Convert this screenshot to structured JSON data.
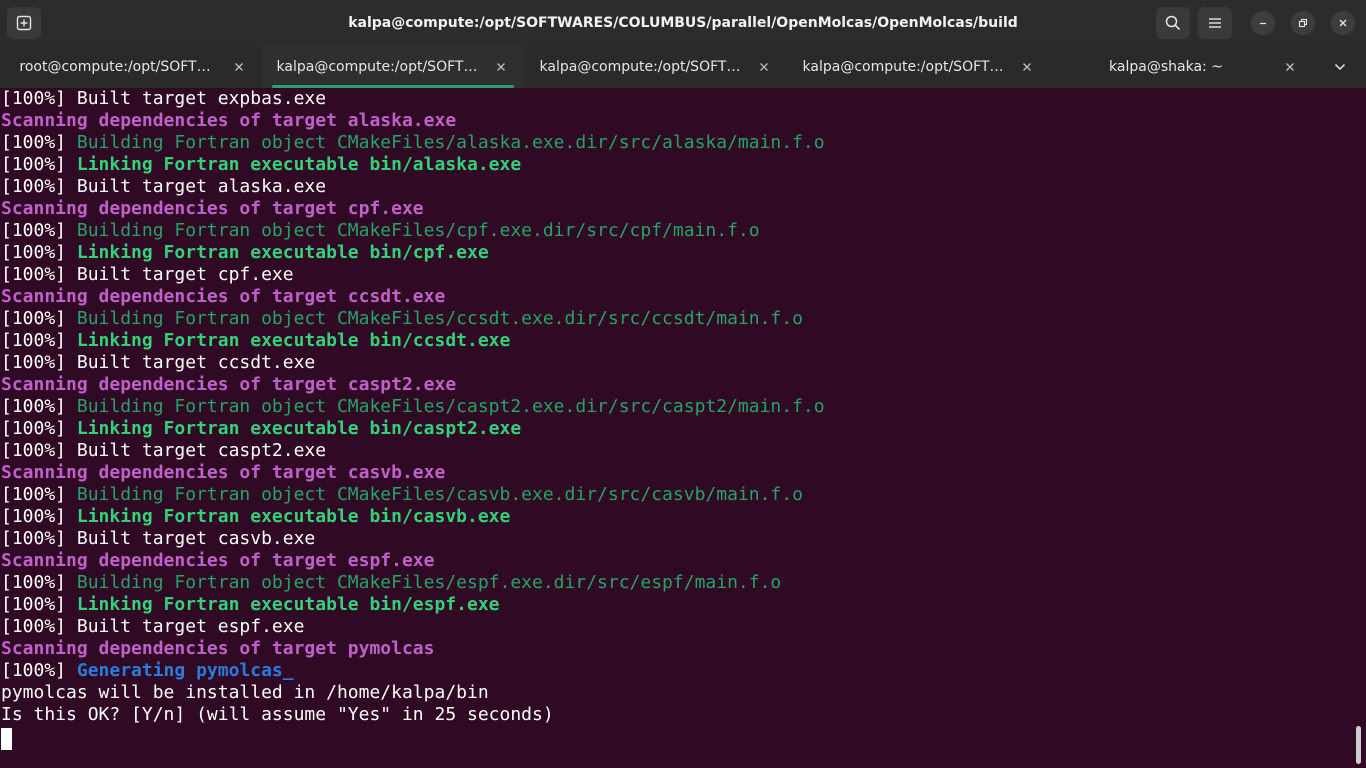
{
  "window": {
    "title": "kalpa@compute:/opt/SOFTWARES/COLUMBUS/parallel/OpenMolcas/OpenMolcas/build"
  },
  "tabs": [
    {
      "label": "root@compute:/opt/SOFT…",
      "active": false
    },
    {
      "label": "kalpa@compute:/opt/SOFT…",
      "active": true
    },
    {
      "label": "kalpa@compute:/opt/SOFT…",
      "active": false
    },
    {
      "label": "kalpa@compute:/opt/SOFT…",
      "active": false
    },
    {
      "label": "kalpa@shaka: ~",
      "active": false
    }
  ],
  "colors": {
    "background": "#300a24",
    "accent": "#2c9e6f",
    "magenta": "#c061cb",
    "green": "#26a269",
    "bright_green": "#33d17a",
    "blue": "#2a7bde"
  },
  "icons": {
    "new_tab": "new-tab-icon",
    "search": "search-icon",
    "menu": "hamburger-menu-icon",
    "minimize": "minimize-icon",
    "maximize": "maximize-icon",
    "close": "close-icon"
  },
  "terminal": {
    "lines": [
      [
        {
          "t": "[100%] Built target expbas.exe",
          "c": "w"
        }
      ],
      [
        {
          "t": "Scanning dependencies of target alaska.exe",
          "c": "m"
        }
      ],
      [
        {
          "t": "[100%] ",
          "c": "w"
        },
        {
          "t": "Building Fortran object CMakeFiles/alaska.exe.dir/src/alaska/main.f.o",
          "c": "g"
        }
      ],
      [
        {
          "t": "[100%] ",
          "c": "w"
        },
        {
          "t": "Linking Fortran executable bin/alaska.exe",
          "c": "gb"
        }
      ],
      [
        {
          "t": "[100%] Built target alaska.exe",
          "c": "w"
        }
      ],
      [
        {
          "t": "Scanning dependencies of target cpf.exe",
          "c": "m"
        }
      ],
      [
        {
          "t": "[100%] ",
          "c": "w"
        },
        {
          "t": "Building Fortran object CMakeFiles/cpf.exe.dir/src/cpf/main.f.o",
          "c": "g"
        }
      ],
      [
        {
          "t": "[100%] ",
          "c": "w"
        },
        {
          "t": "Linking Fortran executable bin/cpf.exe",
          "c": "gb"
        }
      ],
      [
        {
          "t": "[100%] Built target cpf.exe",
          "c": "w"
        }
      ],
      [
        {
          "t": "Scanning dependencies of target ccsdt.exe",
          "c": "m"
        }
      ],
      [
        {
          "t": "[100%] ",
          "c": "w"
        },
        {
          "t": "Building Fortran object CMakeFiles/ccsdt.exe.dir/src/ccsdt/main.f.o",
          "c": "g"
        }
      ],
      [
        {
          "t": "[100%] ",
          "c": "w"
        },
        {
          "t": "Linking Fortran executable bin/ccsdt.exe",
          "c": "gb"
        }
      ],
      [
        {
          "t": "[100%] Built target ccsdt.exe",
          "c": "w"
        }
      ],
      [
        {
          "t": "Scanning dependencies of target caspt2.exe",
          "c": "m"
        }
      ],
      [
        {
          "t": "[100%] ",
          "c": "w"
        },
        {
          "t": "Building Fortran object CMakeFiles/caspt2.exe.dir/src/caspt2/main.f.o",
          "c": "g"
        }
      ],
      [
        {
          "t": "[100%] ",
          "c": "w"
        },
        {
          "t": "Linking Fortran executable bin/caspt2.exe",
          "c": "gb"
        }
      ],
      [
        {
          "t": "[100%] Built target caspt2.exe",
          "c": "w"
        }
      ],
      [
        {
          "t": "Scanning dependencies of target casvb.exe",
          "c": "m"
        }
      ],
      [
        {
          "t": "[100%] ",
          "c": "w"
        },
        {
          "t": "Building Fortran object CMakeFiles/casvb.exe.dir/src/casvb/main.f.o",
          "c": "g"
        }
      ],
      [
        {
          "t": "[100%] ",
          "c": "w"
        },
        {
          "t": "Linking Fortran executable bin/casvb.exe",
          "c": "gb"
        }
      ],
      [
        {
          "t": "[100%] Built target casvb.exe",
          "c": "w"
        }
      ],
      [
        {
          "t": "Scanning dependencies of target espf.exe",
          "c": "m"
        }
      ],
      [
        {
          "t": "[100%] ",
          "c": "w"
        },
        {
          "t": "Building Fortran object CMakeFiles/espf.exe.dir/src/espf/main.f.o",
          "c": "g"
        }
      ],
      [
        {
          "t": "[100%] ",
          "c": "w"
        },
        {
          "t": "Linking Fortran executable bin/espf.exe",
          "c": "gb"
        }
      ],
      [
        {
          "t": "[100%] Built target espf.exe",
          "c": "w"
        }
      ],
      [
        {
          "t": "Scanning dependencies of target pymolcas",
          "c": "m"
        }
      ],
      [
        {
          "t": "[100%] ",
          "c": "w"
        },
        {
          "t": "Generating pymolcas",
          "c": "b"
        },
        {
          "t": "_",
          "c": "b"
        }
      ],
      [
        {
          "t": "pymolcas will be installed in /home/kalpa/bin",
          "c": "w"
        }
      ],
      [
        {
          "t": "Is this OK? [Y/n] (will assume \"Yes\" in 25 seconds)",
          "c": "w"
        }
      ]
    ]
  }
}
